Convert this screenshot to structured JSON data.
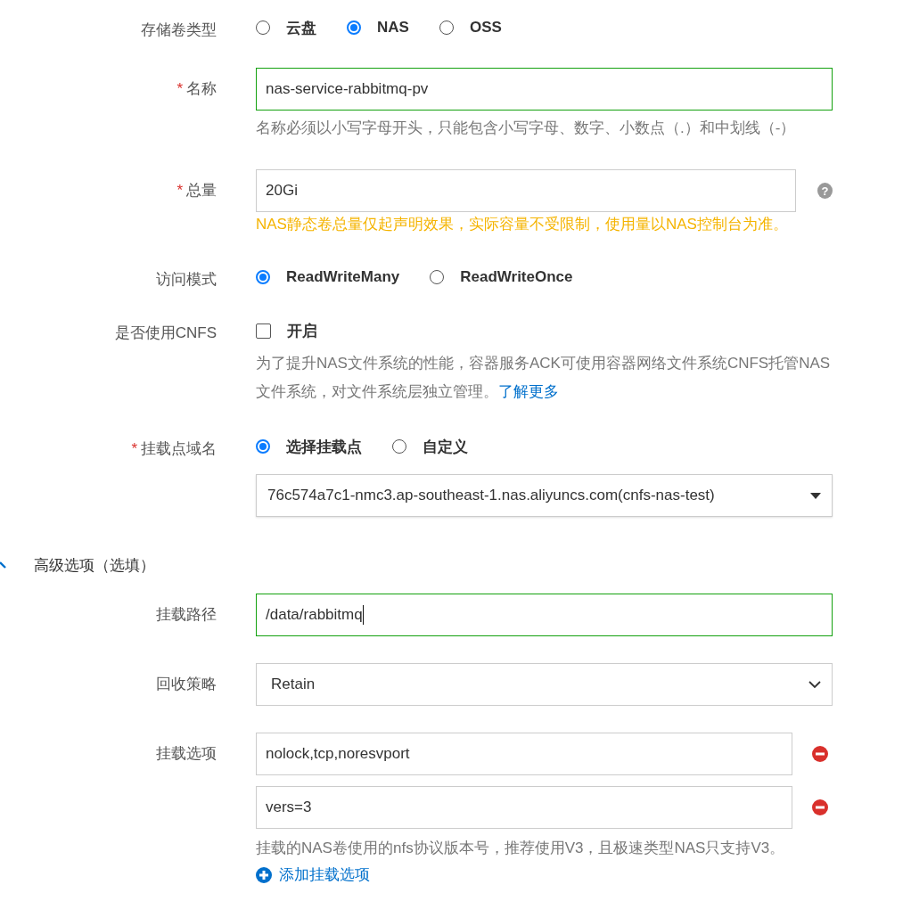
{
  "fields": [
    {
      "kind": "radio",
      "label": "存储卷类型",
      "options": [
        {
          "label": "云盘",
          "selected": false
        },
        {
          "label": "NAS",
          "selected": true
        },
        {
          "label": "OSS",
          "selected": false
        }
      ]
    },
    {
      "kind": "input",
      "label": "名称",
      "required": "*",
      "value": "nas-service-rabbitmq-pv",
      "focused": true,
      "hint": "名称必须以小写字母开头，只能包含小写字母、数字、小数点（.）和中划线（-）"
    },
    {
      "kind": "input",
      "label": "总量",
      "required": "*",
      "value": "20Gi",
      "focused": false,
      "help": "?",
      "warning": "NAS静态卷总量仅起声明效果，实际容量不受限制，使用量以NAS控制台为准。"
    },
    {
      "kind": "radio",
      "label": "访问模式",
      "options": [
        {
          "label": "ReadWriteMany",
          "selected": true
        },
        {
          "label": "ReadWriteOnce",
          "selected": false
        }
      ]
    },
    {
      "kind": "checkbox",
      "label": "是否使用CNFS",
      "checkbox": {
        "label": "开启",
        "checked": false
      },
      "hint": "为了提升NAS文件系统的性能，容器服务ACK可使用容器网络文件系统CNFS托管NAS文件系统，对文件系统层独立管理。",
      "link": "了解更多"
    },
    {
      "kind": "radio",
      "label": "挂载点域名",
      "required": "*",
      "options": [
        {
          "label": "选择挂载点",
          "selected": true
        },
        {
          "label": "自定义",
          "selected": false
        }
      ],
      "dropdown": "76c574a7c1-nmc3.ap-southeast-1.nas.aliyuncs.com(cnfs-nas-test)"
    }
  ],
  "advanced": {
    "title": "高级选项（选填）",
    "expanded": true,
    "fields": [
      {
        "kind": "input",
        "label": "挂载路径",
        "value": "/data/rabbitmq",
        "focused": true
      },
      {
        "kind": "select",
        "label": "回收策略",
        "value": "Retain"
      },
      {
        "kind": "list",
        "label": "挂载选项",
        "items": [
          "nolock,tcp,noresvport",
          "vers=3"
        ],
        "hint": "挂载的NAS卷使用的nfs协议版本号，推荐使用V3，且极速类型NAS只支持V3。",
        "add": "添加挂载选项"
      }
    ]
  }
}
